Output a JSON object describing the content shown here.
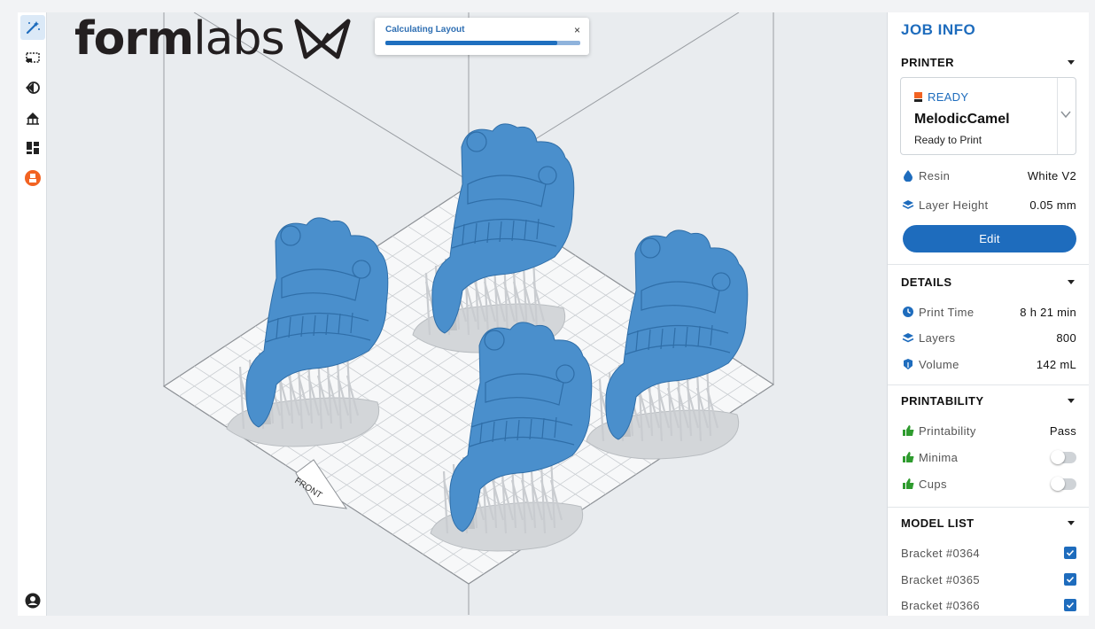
{
  "brand": {
    "logo_text_bold": "form",
    "logo_text_thin": "labs"
  },
  "toolbar": {
    "tools": [
      "magic-wand-icon",
      "select-region-icon",
      "orient-icon",
      "supports-icon",
      "layout-icon",
      "printer-status-icon"
    ],
    "account_icon": "account-icon"
  },
  "progress": {
    "title": "Calculating Layout",
    "close": "×",
    "value": 0.88
  },
  "viewport": {
    "front_label": "FRONT"
  },
  "panel": {
    "title": "JOB INFO",
    "printer": {
      "heading": "PRINTER",
      "status": "READY",
      "name": "MelodicCamel",
      "substatus": "Ready to Print",
      "resin_label": "Resin",
      "resin_value": "White V2",
      "layer_height_label": "Layer Height",
      "layer_height_value": "0.05 mm",
      "edit_label": "Edit"
    },
    "details": {
      "heading": "DETAILS",
      "print_time_label": "Print Time",
      "print_time_value": "8 h 21 min",
      "layers_label": "Layers",
      "layers_value": "800",
      "volume_label": "Volume",
      "volume_value": "142 mL"
    },
    "printability": {
      "heading": "PRINTABILITY",
      "printability_label": "Printability",
      "printability_value": "Pass",
      "minima_label": "Minima",
      "minima_on": false,
      "cups_label": "Cups",
      "cups_on": false
    },
    "model_list": {
      "heading": "MODEL LIST",
      "items": [
        {
          "name": "Bracket #0364",
          "checked": true
        },
        {
          "name": "Bracket #0365",
          "checked": true
        },
        {
          "name": "Bracket #0366",
          "checked": true
        }
      ]
    }
  },
  "colors": {
    "accent": "#1e6cbd",
    "model_blue": "#4a8fcc",
    "support_grey": "#c9ccd0",
    "status_orange": "#f26322",
    "thumb_green": "#2e9b2e"
  }
}
